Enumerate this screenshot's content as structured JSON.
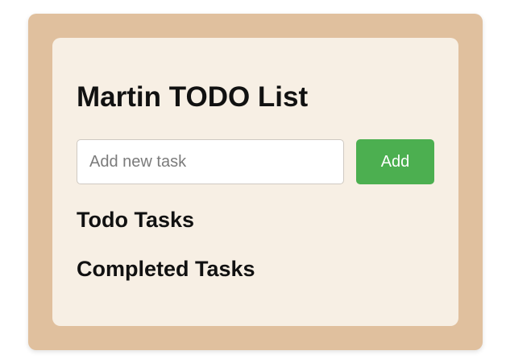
{
  "app": {
    "title": "Martin TODO List"
  },
  "task_entry": {
    "input_value": "",
    "input_placeholder": "Add new task",
    "add_label": "Add"
  },
  "sections": {
    "todo_heading": "Todo Tasks",
    "completed_heading": "Completed Tasks"
  },
  "colors": {
    "frame": "#e0c09e",
    "card": "#f7efe4",
    "accent": "#4caf50"
  }
}
